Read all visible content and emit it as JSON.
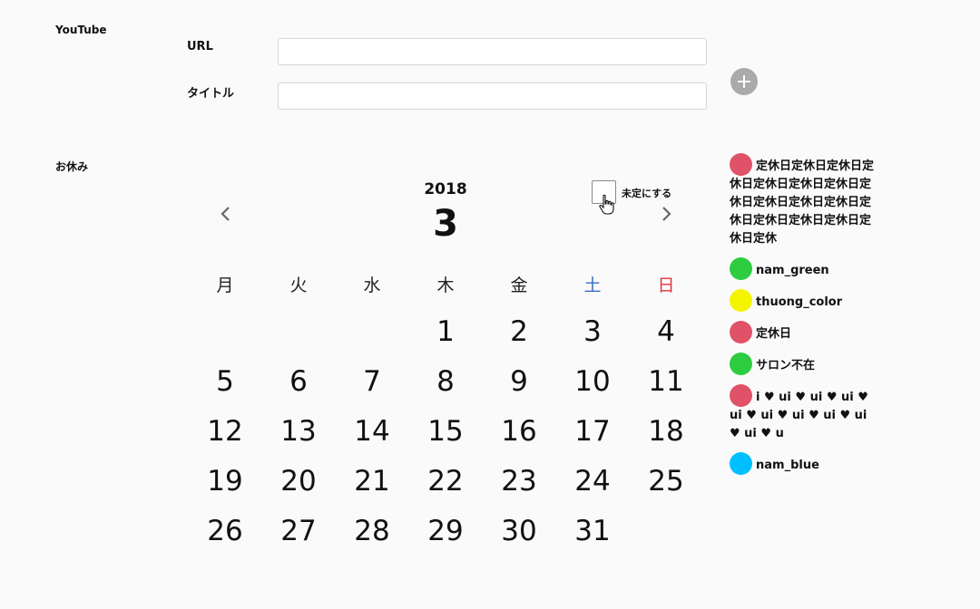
{
  "youtube": {
    "section_label": "YouTube",
    "url_label": "URL",
    "url_value": "",
    "title_label": "タイトル",
    "title_value": ""
  },
  "holidays": {
    "section_label": "お休み"
  },
  "calendar": {
    "year": "2018",
    "month": "3",
    "undecided_label": "未定にする",
    "weekdays": [
      "月",
      "火",
      "水",
      "木",
      "金",
      "土",
      "日"
    ],
    "weekday_colors": [
      "#222222",
      "#222222",
      "#222222",
      "#222222",
      "#222222",
      "#3a6fc4",
      "#e0343f"
    ],
    "first_weekday_index": 3,
    "days_in_month": 31
  },
  "legend": [
    {
      "label": "定休日定休日定休日定休日定休日定休日定休日定休日定休日定休日定休日定休日定休日定休日定休日定休日定休",
      "color": "#e05268"
    },
    {
      "label": "nam_green",
      "color": "#2ecc40"
    },
    {
      "label": "thuong_color",
      "color": "#f5f500"
    },
    {
      "label": "定休日",
      "color": "#e05268"
    },
    {
      "label": "サロン不在",
      "color": "#2ecc40"
    },
    {
      "label": "i ♥ ui ♥ ui ♥ ui ♥ ui ♥ ui ♥ ui ♥ ui ♥ ui ♥ ui ♥ u",
      "color": "#e05268"
    },
    {
      "label": "nam_blue",
      "color": "#00bfff"
    }
  ]
}
